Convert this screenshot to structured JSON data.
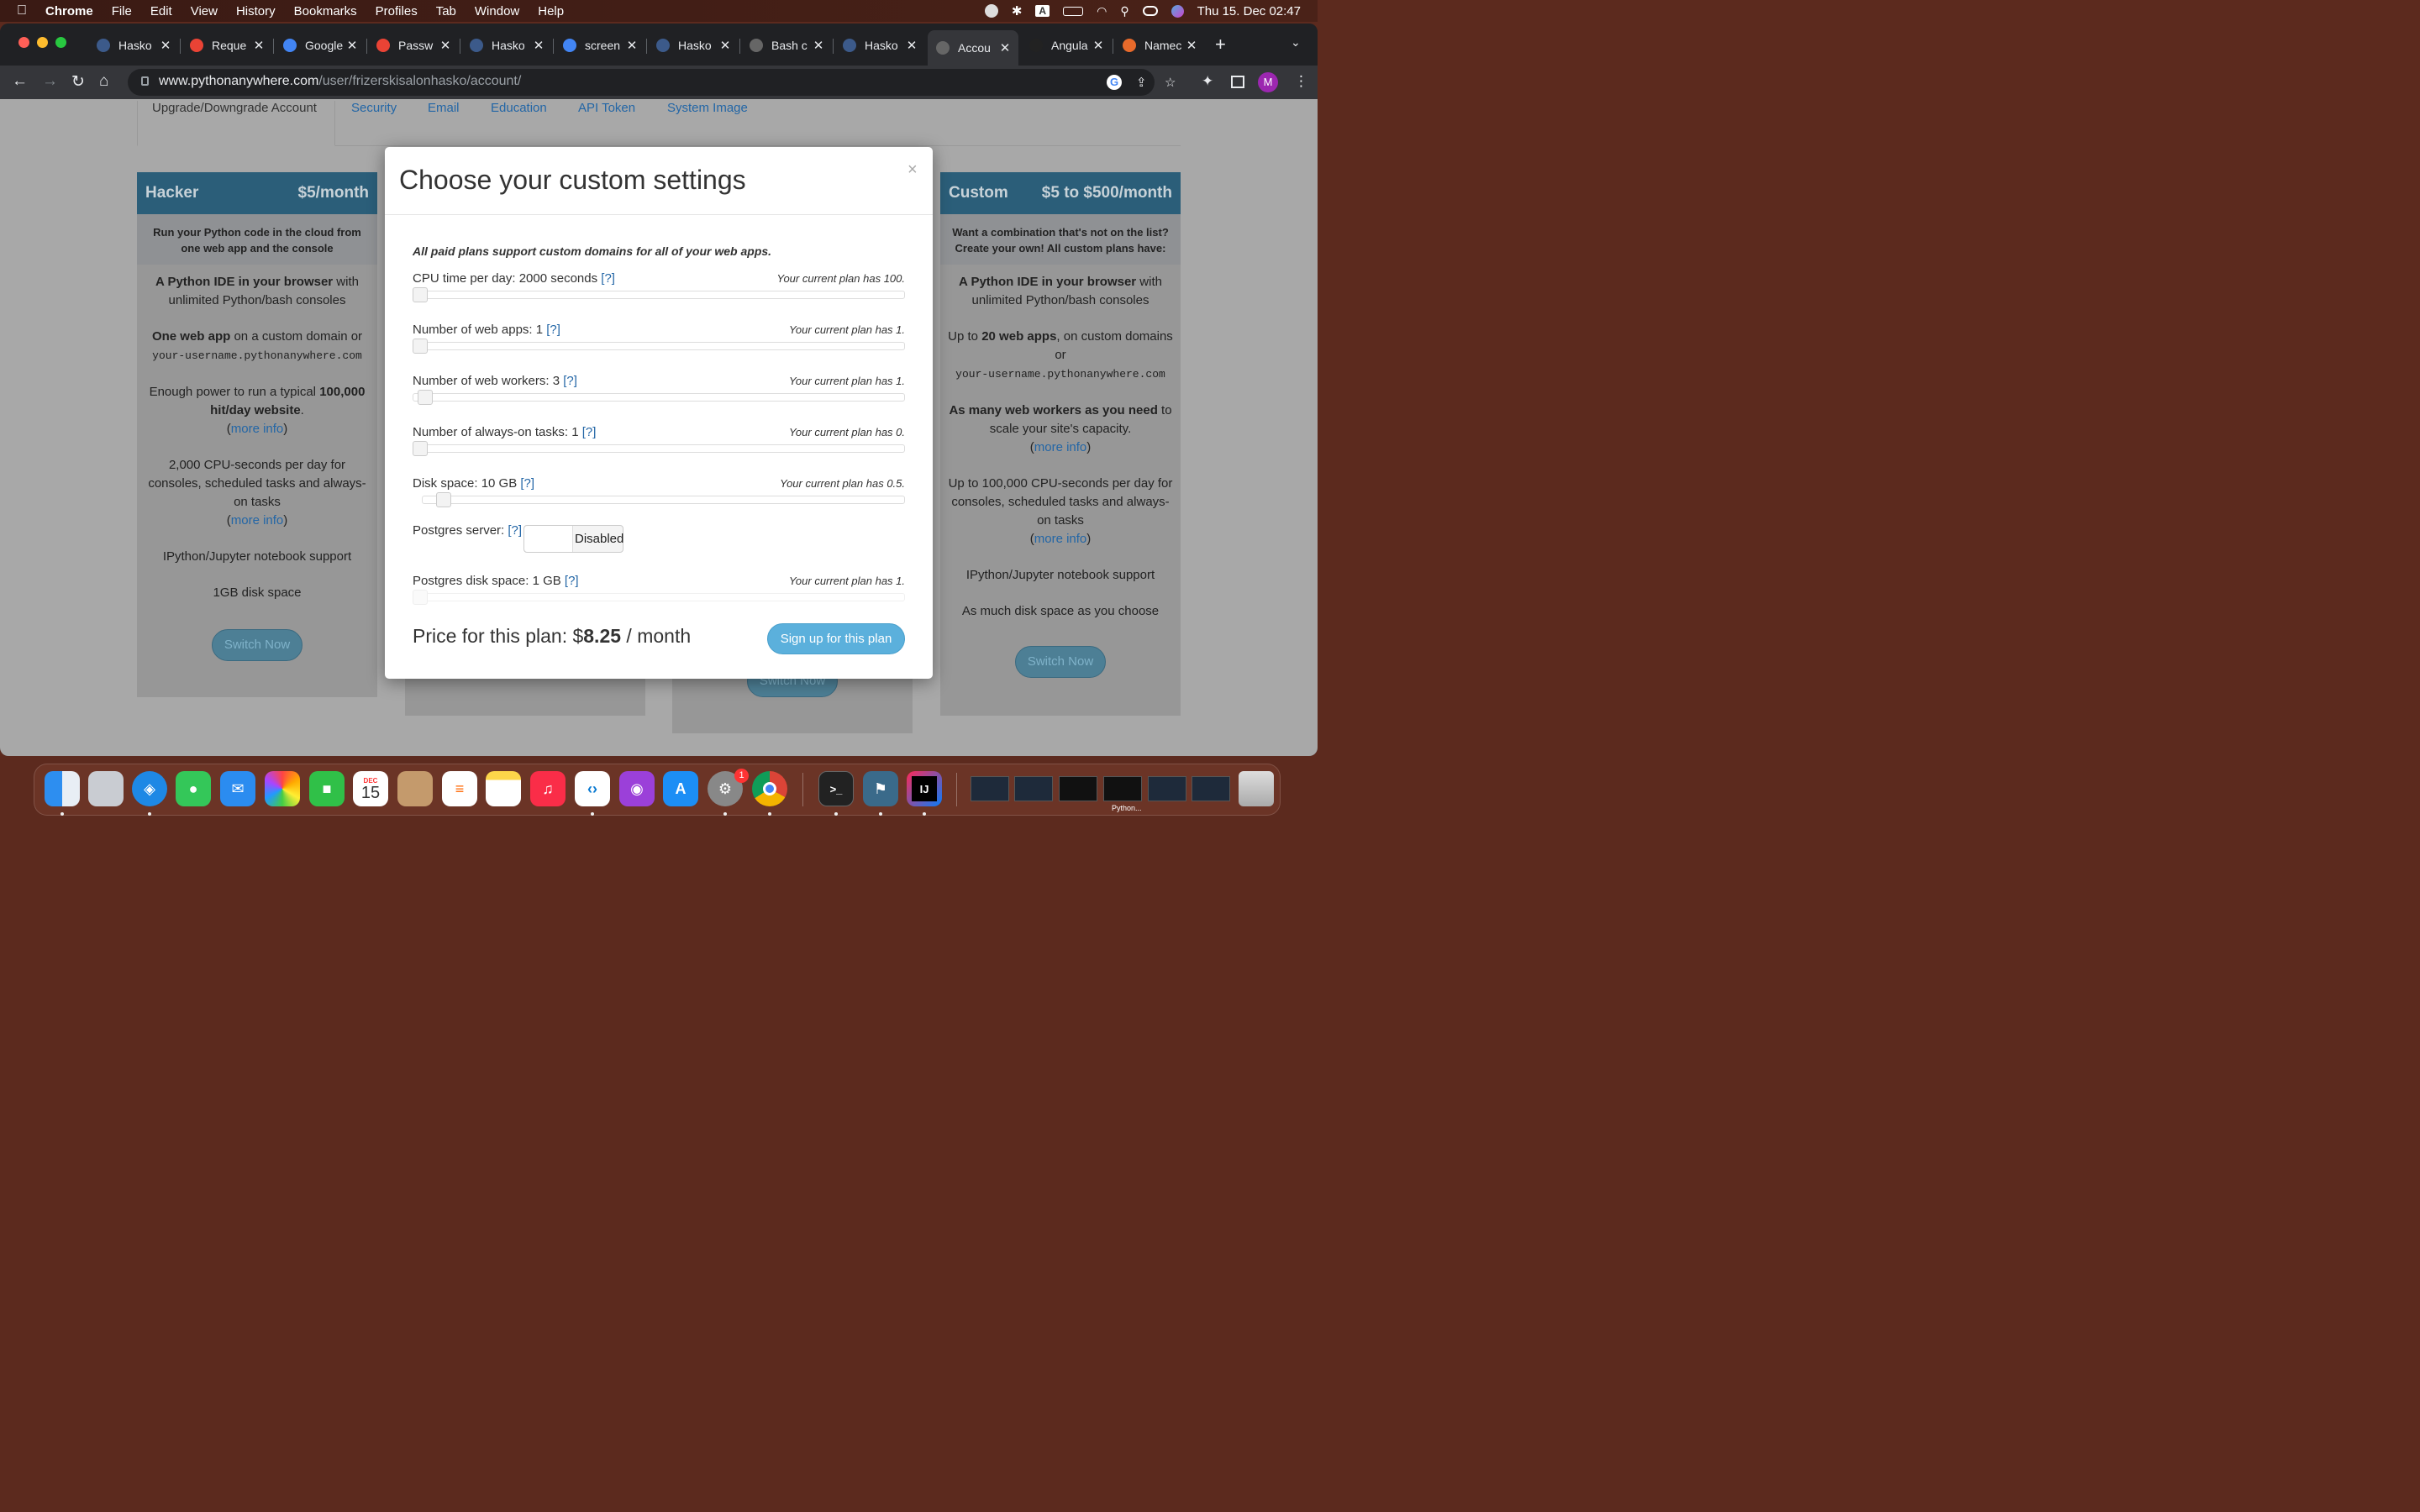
{
  "menubar": {
    "app": "Chrome",
    "items": [
      "File",
      "Edit",
      "View",
      "History",
      "Bookmarks",
      "Profiles",
      "Tab",
      "Window",
      "Help"
    ],
    "clock": "Thu 15. Dec  02:47",
    "input_source": "A"
  },
  "tabs": [
    {
      "title": "Hasko",
      "icon": "python-icon",
      "color": "#3c5a8a"
    },
    {
      "title": "Reque",
      "icon": "gmail-icon",
      "color": "#ea4335"
    },
    {
      "title": "Google",
      "icon": "google-icon",
      "color": "#4285f4"
    },
    {
      "title": "Passw",
      "icon": "gmail-icon",
      "color": "#ea4335"
    },
    {
      "title": "Hasko",
      "icon": "python-icon",
      "color": "#3c5a8a"
    },
    {
      "title": "screen",
      "icon": "google-icon",
      "color": "#4285f4"
    },
    {
      "title": "Hasko",
      "icon": "python-icon",
      "color": "#3c5a8a"
    },
    {
      "title": "Bash c",
      "icon": "python-icon",
      "color": "#666666"
    },
    {
      "title": "Hasko",
      "icon": "python-icon",
      "color": "#3c5a8a"
    },
    {
      "title": "Accou",
      "icon": "python-icon",
      "color": "#666666",
      "active": true
    },
    {
      "title": "Angula",
      "icon": "angular-icon",
      "color": "#222222"
    },
    {
      "title": "Namec",
      "icon": "namecheap-icon",
      "color": "#e86a2b"
    }
  ],
  "address": {
    "host": "www.pythonanywhere.com",
    "path": "/user/frizerskisalonhasko/account/"
  },
  "profile_initial": "M",
  "subnav": {
    "tabs": [
      "Upgrade/Downgrade Account",
      "Security",
      "Email",
      "Education",
      "API Token",
      "System Image"
    ]
  },
  "hacker_card": {
    "name": "Hacker",
    "price": "$5/month",
    "subtitle": "Run your Python code in the cloud from one web app and the console",
    "f1_bold": "A Python IDE in your browser",
    "f1_rest": " with unlimited Python/bash consoles",
    "f2_bold": "One web app",
    "f2_rest": " on a custom domain or",
    "f2_mono": "your-username.pythonanywhere.com",
    "f3_pre": "Enough power to run a typical ",
    "f3_bold": "100,000 hit/day website",
    "f3_post": ".",
    "more_info": "more info",
    "f4": "2,000 CPU-seconds per day for consoles, scheduled tasks and always-on tasks",
    "f5": "IPython/Jupyter notebook support",
    "f6": "1GB disk space",
    "button": "Switch Now"
  },
  "custom_card": {
    "name": "Custom",
    "price": "$5 to $500/month",
    "subtitle": "Want a combination that's not on the list? Create your own! All custom plans have:",
    "f1_bold": "A Python IDE in your browser",
    "f1_rest": " with unlimited Python/bash consoles",
    "f2_pre": "Up to ",
    "f2_bold": "20 web apps",
    "f2_rest": ", on custom domains or",
    "f2_mono": "your-username.pythonanywhere.com",
    "f3_bold": "As many web workers as you need",
    "f3_rest": " to scale your site's capacity.",
    "more_info": "more info",
    "f4": "Up to 100,000 CPU-seconds per day for consoles, scheduled tasks and always-on tasks",
    "f5": "IPython/Jupyter notebook support",
    "f6": "As much disk space as you choose",
    "button": "Switch Now"
  },
  "hidden_card_button": "Switch Now",
  "modal": {
    "title": "Choose your custom settings",
    "close": "×",
    "note": "All paid plans support custom domains for all of your web apps.",
    "help": "[?]",
    "rows": [
      {
        "label": "CPU time per day: 2000 seconds",
        "current": "Your current plan has 100.",
        "level": 0
      },
      {
        "label": "Number of web apps: 1",
        "current": "Your current plan has 1.",
        "level": 0
      },
      {
        "label": "Number of web workers: 3",
        "current": "Your current plan has 1.",
        "level": 0.01
      },
      {
        "label": "Number of always-on tasks: 1",
        "current": "Your current plan has 0.",
        "level": 0
      },
      {
        "label": "Disk space: 10 GB",
        "current": "Your current plan has 0.5.",
        "level": 0.03
      }
    ],
    "postgres_label": "Postgres server:",
    "postgres_state": "Disabled",
    "pg_disk": {
      "label": "Postgres disk space: 1 GB",
      "current": "Your current plan has 1.",
      "level": 0
    },
    "price_pre": "Price for this plan: $",
    "price_value": "8.25",
    "price_post": " / month",
    "signup": "Sign up for this plan"
  },
  "dock": {
    "calendar_month": "DEC",
    "calendar_day": "15",
    "settings_badge": "1",
    "window_label": "Python..."
  }
}
